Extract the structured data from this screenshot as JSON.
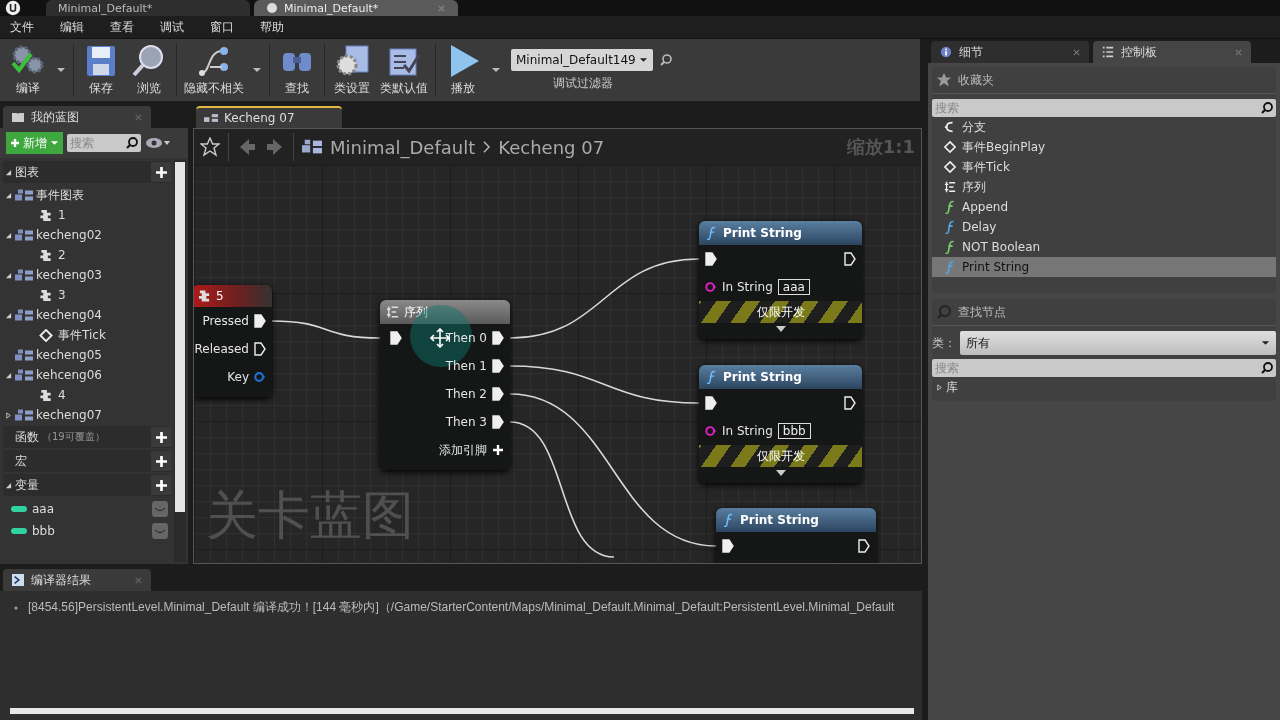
{
  "document_tabs": [
    {
      "title": "Minimal_Default*",
      "selected": false
    },
    {
      "title": "Minimal_Default*",
      "selected": true
    }
  ],
  "menu": [
    "文件",
    "编辑",
    "查看",
    "调试",
    "窗口",
    "帮助"
  ],
  "toolbar": [
    {
      "kind": "compile",
      "label": "编译",
      "dropdown": true
    },
    {
      "kind": "save",
      "label": "保存",
      "dropdown": false
    },
    {
      "kind": "browse",
      "label": "浏览",
      "dropdown": false
    },
    {
      "kind": "hide",
      "label": "隐藏不相关",
      "dropdown": true
    },
    {
      "kind": "find",
      "label": "查找",
      "dropdown": false
    },
    {
      "kind": "class_settings",
      "label": "类设置",
      "dropdown": false
    },
    {
      "kind": "class_defaults",
      "label": "类默认值",
      "dropdown": false
    },
    {
      "kind": "play",
      "label": "播放",
      "dropdown": true
    }
  ],
  "debug_filter": {
    "value": "Minimal_Default149",
    "label": "调试过滤器"
  },
  "my_blueprint": {
    "tab": "我的蓝图",
    "new_label": "新增",
    "search_placeholder": "搜索",
    "sections": [
      {
        "title": "图表",
        "expanded": true,
        "items": [
          {
            "label": "事件图表",
            "kind": "graph",
            "expanded": true,
            "children": [
              {
                "label": "1",
                "kind": "comment"
              }
            ]
          },
          {
            "label": "kecheng02",
            "kind": "graph",
            "expanded": true,
            "children": [
              {
                "label": "2",
                "kind": "comment"
              }
            ]
          },
          {
            "label": "kecheng03",
            "kind": "graph",
            "expanded": true,
            "children": [
              {
                "label": "3",
                "kind": "comment"
              }
            ]
          },
          {
            "label": "kecheng04",
            "kind": "graph",
            "expanded": true,
            "children": [
              {
                "label": "事件Tick",
                "kind": "event"
              }
            ]
          },
          {
            "label": "kecheng05",
            "kind": "graph"
          },
          {
            "label": "kehceng06",
            "kind": "graph",
            "expanded": true,
            "children": [
              {
                "label": "4",
                "kind": "comment"
              }
            ]
          },
          {
            "label": "kecheng07",
            "kind": "graph",
            "expanded": false
          }
        ]
      },
      {
        "title": "函数",
        "note": "（19可覆盖）"
      },
      {
        "title": "宏"
      },
      {
        "title": "变量",
        "expanded": true,
        "variables": [
          "aaa",
          "bbb"
        ]
      }
    ]
  },
  "graph": {
    "tab": "Kecheng 07",
    "breadcrumb": [
      "Minimal_Default",
      "Kecheng 07"
    ],
    "zoom": "缩放1:1",
    "watermark": "关卡蓝图",
    "nodes": [
      {
        "kind": "key_event",
        "title": "5",
        "pins": [
          {
            "label": "Pressed",
            "kind": "exec",
            "connected": true
          },
          {
            "label": "Released",
            "kind": "exec",
            "connected": false
          },
          {
            "label": "Key",
            "kind": "struct",
            "connected": false
          }
        ]
      },
      {
        "kind": "sequence",
        "title": "序列",
        "in_connected": true,
        "outputs": [
          {
            "label": "Then 0",
            "connected": true
          },
          {
            "label": "Then 1",
            "connected": true
          },
          {
            "label": "Then 2",
            "connected": true
          },
          {
            "label": "Then 3",
            "connected": true
          }
        ],
        "add_pin": "添加引脚"
      },
      {
        "kind": "function",
        "title": "Print String",
        "in_connected": true,
        "out_connected": false,
        "in_string_label": "In String",
        "in_string": "aaa",
        "dev_only": "仅限开发"
      },
      {
        "kind": "function",
        "title": "Print String",
        "in_connected": true,
        "out_connected": false,
        "in_string_label": "In String",
        "in_string": "bbb",
        "dev_only": "仅限开发"
      },
      {
        "kind": "function",
        "title": "Print String",
        "in_connected": true,
        "out_connected": false
      }
    ]
  },
  "compiler": {
    "tab": "编译器结果",
    "messages": [
      "[8454.56]PersistentLevel.Minimal_Default 编译成功！[144 毫秒内]（/Game/StarterContent/Maps/Minimal_Default.Minimal_Default:PersistentLevel.Minimal_Default"
    ]
  },
  "right_panel": {
    "tabs": [
      {
        "label": "细节",
        "kind": "details",
        "selected": false
      },
      {
        "label": "控制板",
        "kind": "palette",
        "selected": true
      }
    ],
    "favorites": {
      "title": "收藏夹",
      "search_placeholder": "搜索",
      "items": [
        {
          "label": "分支",
          "kind": "branch",
          "selected": false
        },
        {
          "label": "事件BeginPlay",
          "kind": "event",
          "selected": false
        },
        {
          "label": "事件Tick",
          "kind": "event",
          "selected": false
        },
        {
          "label": "序列",
          "kind": "sequence",
          "selected": false
        },
        {
          "label": "Append",
          "kind": "function",
          "color": "#7ccf6a",
          "selected": false
        },
        {
          "label": "Delay",
          "kind": "function",
          "color": "#4fa8e6",
          "selected": false
        },
        {
          "label": "NOT Boolean",
          "kind": "function",
          "color": "#7ccf6a",
          "selected": false
        },
        {
          "label": "Print String",
          "kind": "function",
          "color": "#4fa8e6",
          "selected": true
        }
      ]
    },
    "find_node": {
      "title": "查找节点",
      "class_label": "类：",
      "class_value": "所有",
      "search_placeholder": "搜索",
      "library": "库",
      "library_expanded": false
    }
  }
}
